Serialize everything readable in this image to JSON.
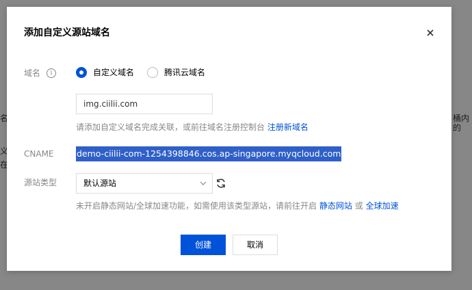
{
  "background": {
    "fragments": [
      "名",
      "义",
      "在",
      "桶内的"
    ]
  },
  "dialog": {
    "title": "添加自定义源站域名",
    "domain": {
      "label": "域名",
      "options": [
        "自定义域名",
        "腾讯云域名"
      ],
      "selected": "自定义域名",
      "value": "img.ciilii.com",
      "help_text": "请添加自定义域名完成关联，或前往域名注册控制台",
      "help_link": "注册新域名"
    },
    "cname": {
      "label": "CNAME",
      "value": "demo-ciilii-com-1254398846.cos.ap-singapore.myqcloud.com"
    },
    "origin_type": {
      "label": "源站类型",
      "selected": "默认源站",
      "help_prefix": "未开启静态网站/全球加速功能，如需使用该类型源站，请前往开启",
      "link_static": "静态网站",
      "or": "或",
      "link_accel": "全球加速"
    },
    "buttons": {
      "create": "创建",
      "cancel": "取消"
    }
  },
  "colors": {
    "primary": "#0052d9",
    "selection": "#2f5fc8"
  }
}
